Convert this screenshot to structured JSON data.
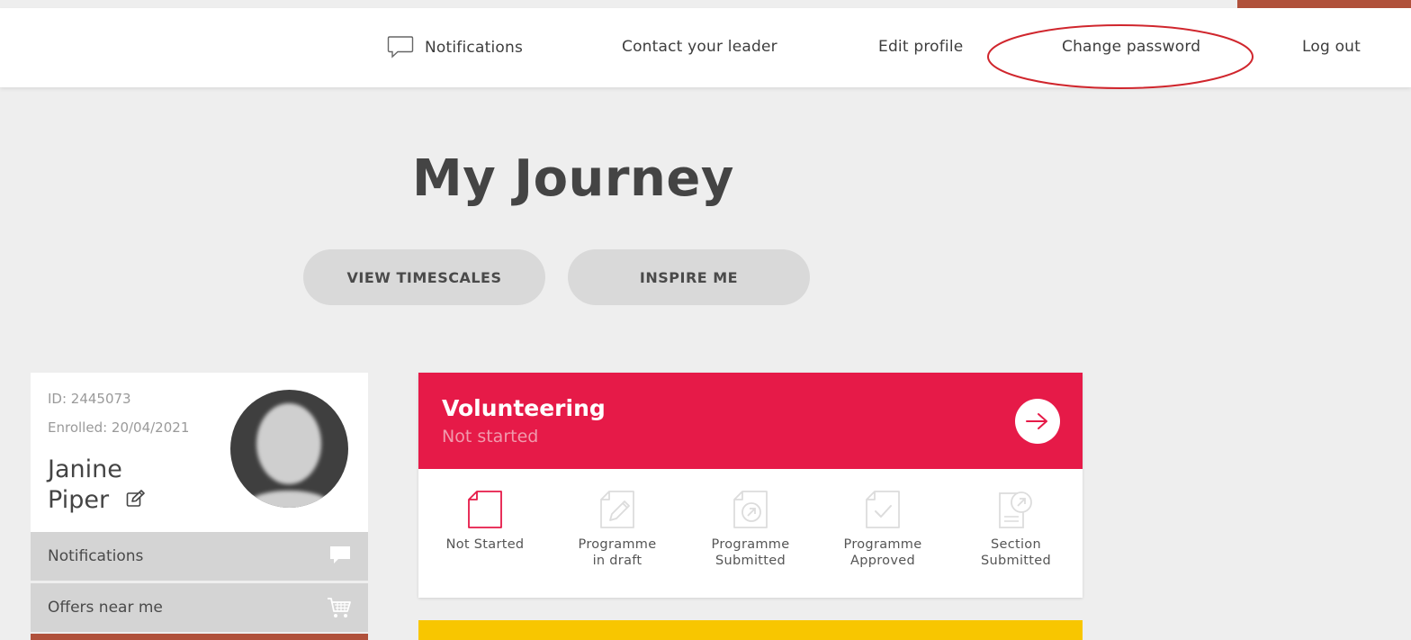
{
  "nav": {
    "notifications": "Notifications",
    "contact_leader": "Contact your leader",
    "edit_profile": "Edit profile",
    "change_password": "Change password",
    "log_out": "Log out"
  },
  "page": {
    "title": "My Journey",
    "buttons": {
      "view_timescales": "VIEW TIMESCALES",
      "inspire_me": "INSPIRE ME"
    }
  },
  "profile": {
    "id": "ID: 2445073",
    "enrolled": "Enrolled: 20/04/2021",
    "first_name": "Janine",
    "last_name": "Piper"
  },
  "sidebar": {
    "items": [
      {
        "label": "Notifications",
        "icon": "speech-bubble-icon"
      },
      {
        "label": "Offers near me",
        "icon": "shopping-cart-icon"
      }
    ]
  },
  "section": {
    "title": "Volunteering",
    "status": "Not started",
    "steps": [
      {
        "line1": "Not Started",
        "line2": "",
        "active": true
      },
      {
        "line1": "Programme",
        "line2": "in draft",
        "active": false
      },
      {
        "line1": "Programme",
        "line2": "Submitted",
        "active": false
      },
      {
        "line1": "Programme",
        "line2": "Approved",
        "active": false
      },
      {
        "line1": "Section",
        "line2": "Submitted",
        "active": false
      }
    ]
  },
  "colors": {
    "volunteering": "#e61a48",
    "next_section": "#f8c600",
    "accent": "#b0513b",
    "annotation": "#d0262d"
  }
}
